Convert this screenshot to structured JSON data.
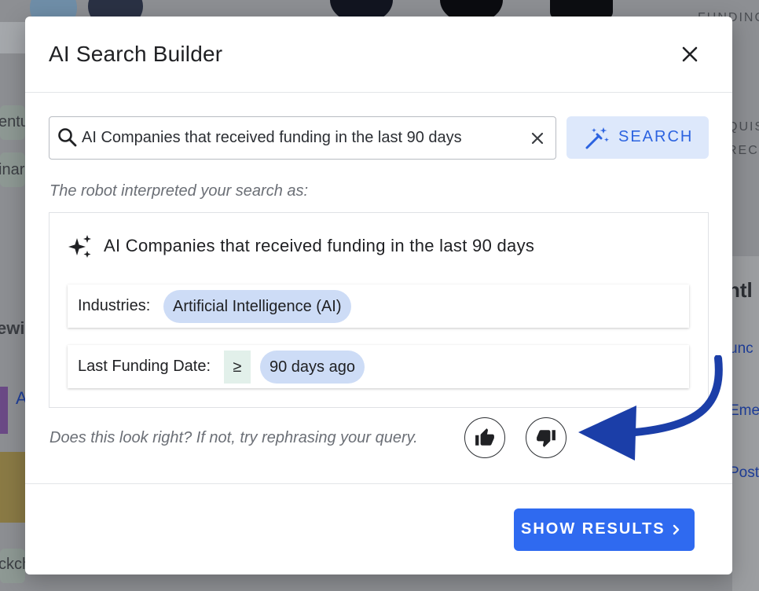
{
  "background": {
    "right_header": "FUNDING",
    "right_acq_1": "QUIS",
    "right_acq_2": "RECO",
    "right_recent": "ntl",
    "right_link_1": "unc",
    "right_link_2": "Eme",
    "right_link_3": "Post",
    "left_tag_1": "entu",
    "left_tag_2": "inar",
    "left_following": "ewin",
    "left_company_initial": "A",
    "left_tag_3": "ckch"
  },
  "modal": {
    "title": "AI Search Builder",
    "search": {
      "value": "AI Companies that received funding in the last 90 days",
      "button_label": "SEARCH"
    },
    "interpretation": {
      "label": "The robot interpreted your search as:",
      "query": "AI Companies that received funding in the last 90 days",
      "filters": [
        {
          "label": "Industries:",
          "operator": "",
          "value": "Artificial Intelligence (AI)"
        },
        {
          "label": "Last Funding Date:",
          "operator": "≥",
          "value": "90 days ago"
        }
      ]
    },
    "feedback": {
      "prompt": "Does this look right? If not, try rephrasing your query."
    },
    "footer": {
      "show_results_label": "SHOW RESULTS"
    }
  },
  "colors": {
    "primary": "#2f6af0",
    "search_button_bg": "#dde8fb",
    "chip_bg": "#cddcf6",
    "operator_bg": "#e2f0ea",
    "arrow": "#1b3ea8"
  },
  "icons": [
    "search-icon",
    "clear-icon",
    "magic-wand-icon",
    "sparkle-icon",
    "thumbs-up-icon",
    "thumbs-down-icon",
    "close-icon",
    "chevron-right-icon",
    "arrow-annotation"
  ]
}
